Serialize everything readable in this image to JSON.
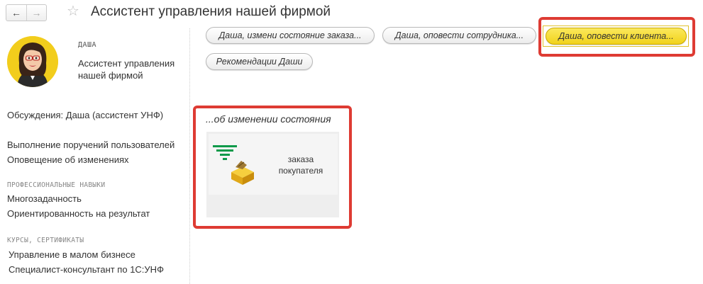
{
  "header": {
    "back_icon": "←",
    "forward_icon": "→",
    "star_icon": "☆",
    "title": "Ассистент управления нашей фирмой"
  },
  "assistant": {
    "name": "ДАША",
    "role": "Ассистент управления нашей фирмой"
  },
  "left": {
    "discussions": "Обсуждения: Даша (ассистент УНФ)",
    "duties": [
      "Выполнение поручений пользователей",
      "Оповещение об изменениях"
    ],
    "skills_heading": "ПРОФЕССИОНАЛЬНЫЕ НАВЫКИ",
    "skills": [
      "Многозадачность",
      "Ориентированность на результат"
    ],
    "courses_heading": "КУРСЫ, СЕРТИФИКАТЫ",
    "courses": [
      "Управление в малом бизнесе",
      "Специалист-консультант по 1С:УНФ"
    ]
  },
  "commands": {
    "change_order_status": "Даша, измени состояние заказа...",
    "notify_employee": "Даша, оповести сотрудника...",
    "notify_client": "Даша, оповести клиента...",
    "recommendations": "Рекомендации Даши"
  },
  "status_section": {
    "title": "...об изменении состояния",
    "tile_label_line1": "заказа",
    "tile_label_line2": "покупателя",
    "tile_icon": "funnel-box-icon"
  },
  "colors": {
    "accent_highlight": "#de3b33",
    "active_button": "#f4d52a",
    "funnel": "#0e9a4a",
    "box": "#e8b21c"
  }
}
